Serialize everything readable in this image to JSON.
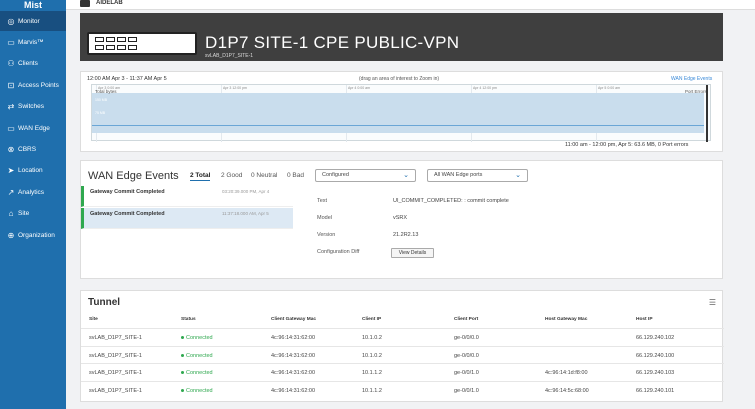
{
  "brand": "Mist",
  "org": "AIDELAB",
  "nav": [
    {
      "label": "Monitor",
      "icon": "monitor-icon",
      "glyph": "◎"
    },
    {
      "label": "Marvis™",
      "icon": "marvis-icon",
      "glyph": "▭"
    },
    {
      "label": "Clients",
      "icon": "clients-icon",
      "glyph": "⚇"
    },
    {
      "label": "Access Points",
      "icon": "access-points-icon",
      "glyph": "⊡"
    },
    {
      "label": "Switches",
      "icon": "switches-icon",
      "glyph": "⇄"
    },
    {
      "label": "WAN Edge",
      "icon": "wan-edge-icon",
      "glyph": "▭"
    },
    {
      "label": "CBRS",
      "icon": "cbrs-icon",
      "glyph": "⊗"
    },
    {
      "label": "Location",
      "icon": "location-icon",
      "glyph": "➤"
    },
    {
      "label": "Analytics",
      "icon": "analytics-icon",
      "glyph": "↗"
    },
    {
      "label": "Site",
      "icon": "site-icon",
      "glyph": "⌂"
    },
    {
      "label": "Organization",
      "icon": "organization-icon",
      "glyph": "⊕"
    }
  ],
  "header": {
    "title": "D1P7 SITE-1 CPE PUBLIC-VPN",
    "subtitle": "svLAB_D1P7_SITE-1"
  },
  "chart": {
    "range": "12:00 AM Apr 3 - 11:37 AM Apr 5",
    "hint": "(drag an area of interest to Zoom in)",
    "link": "WAN Edge Events",
    "legend_total": "Total bytes",
    "legend_errors": "Port Errors",
    "y_labels": [
      "150 MB",
      "75 MB"
    ],
    "tick_labels": [
      "Apr 3 0:00 am",
      "Apr 3 12:00 pm",
      "Apr 4 0:00 am",
      "Apr 4 12:00 pm",
      "Apr 5 0:00 am"
    ],
    "summary": "11:00 am - 12:00 pm, Apr 5: 63.6 MB, 0 Port errors"
  },
  "events": {
    "title": "WAN Edge Events",
    "tabs": [
      "2 Total",
      "2 Good",
      "0 Neutral",
      "0 Bad"
    ],
    "filter1": "Configured",
    "filter2": "All WAN Edge ports",
    "list": [
      {
        "name": "Gateway Commit Completed",
        "time": "03:20:39.000 PM, Apr 4"
      },
      {
        "name": "Gateway Commit Completed",
        "time": "11:37:18.000 AM, Apr 5"
      }
    ],
    "details": {
      "text_label": "Text",
      "text_value": "UI_COMMIT_COMPLETED: : commit complete",
      "model_label": "Model",
      "model_value": "vSRX",
      "version_label": "Version",
      "version_value": "21.2R2.13",
      "diff_label": "Configuration Diff",
      "button": "View Details"
    }
  },
  "tunnel": {
    "title": "Tunnel",
    "headers": [
      "Site",
      "Status",
      "Client Gateway Mac",
      "Client IP",
      "Client Port",
      "Host Gateway Mac",
      "Host IP"
    ],
    "rows": [
      [
        "svLAB_D1P7_SITE-1",
        "Connected",
        "4c:96:14:31:62:00",
        "10.1.0.2",
        "ge-0/0/0.0",
        "",
        "66.129.240.102"
      ],
      [
        "svLAB_D1P7_SITE-1",
        "Connected",
        "4c:96:14:31:62:00",
        "10.1.0.2",
        "ge-0/0/0.0",
        "",
        "66.129.240.100"
      ],
      [
        "svLAB_D1P7_SITE-1",
        "Connected",
        "4c:96:14:31:62:00",
        "10.1.1.2",
        "ge-0/0/1.0",
        "4c:96:14:1d:f8:00",
        "66.129.240.103"
      ],
      [
        "svLAB_D1P7_SITE-1",
        "Connected",
        "4c:96:14:31:62:00",
        "10.1.1.2",
        "ge-0/0/1.0",
        "4c:96:14:5c:68:00",
        "66.129.240.101"
      ]
    ]
  },
  "colors": {
    "sidebar": "#1f6fad",
    "connected": "#2fa84f",
    "header": "#3f3f3f"
  }
}
